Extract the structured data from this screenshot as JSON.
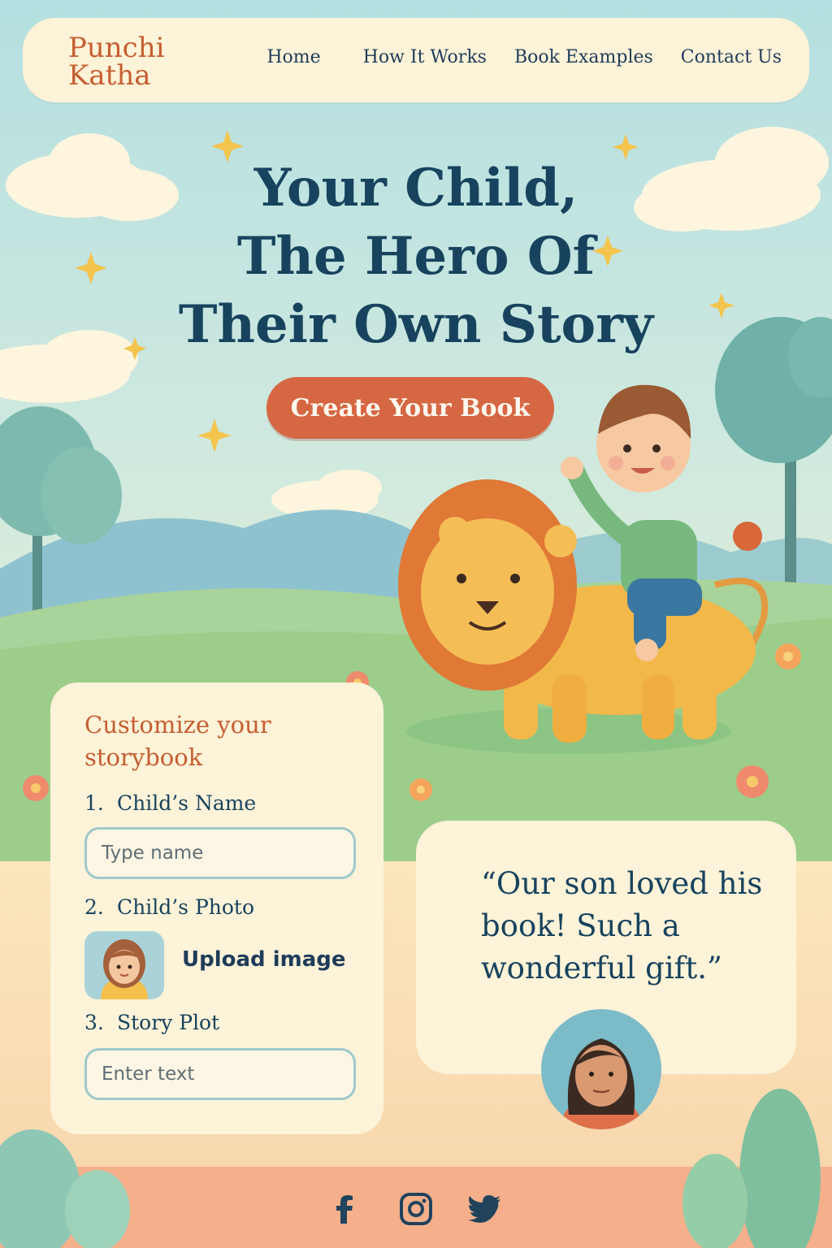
{
  "brand": {
    "name_line1": "Punchi",
    "name_line2": "Katha"
  },
  "nav": {
    "items": [
      {
        "label": "Home"
      },
      {
        "label": "How It Works"
      },
      {
        "label": "Book Examples"
      },
      {
        "label": "Contact Us"
      }
    ]
  },
  "hero": {
    "title_line1": "Your Child,",
    "title_line2": "The Hero Of",
    "title_line3": "Their Own Story",
    "cta_label": "Create Your Book"
  },
  "form": {
    "title": "Customize your storybook",
    "steps": [
      {
        "number": "1.",
        "label": "Child’s Name",
        "placeholder": "Type name"
      },
      {
        "number": "2.",
        "label": "Child’s Photo",
        "action": "Upload image"
      },
      {
        "number": "3.",
        "label": "Story Plot",
        "placeholder": "Enter text"
      }
    ]
  },
  "testimonial": {
    "quote": "“Our son loved his book! Such a wonderful gift.”"
  },
  "footer": {
    "social_icons": [
      "facebook-icon",
      "instagram-icon",
      "twitter-icon"
    ]
  },
  "colors": {
    "sky": "#bfe3df",
    "brand": "#c65e32",
    "heading": "#17435e",
    "cta": "#d66743",
    "card": "#fdf3d8",
    "grass": "#9fcf8b",
    "footer": "#f5b08b"
  }
}
